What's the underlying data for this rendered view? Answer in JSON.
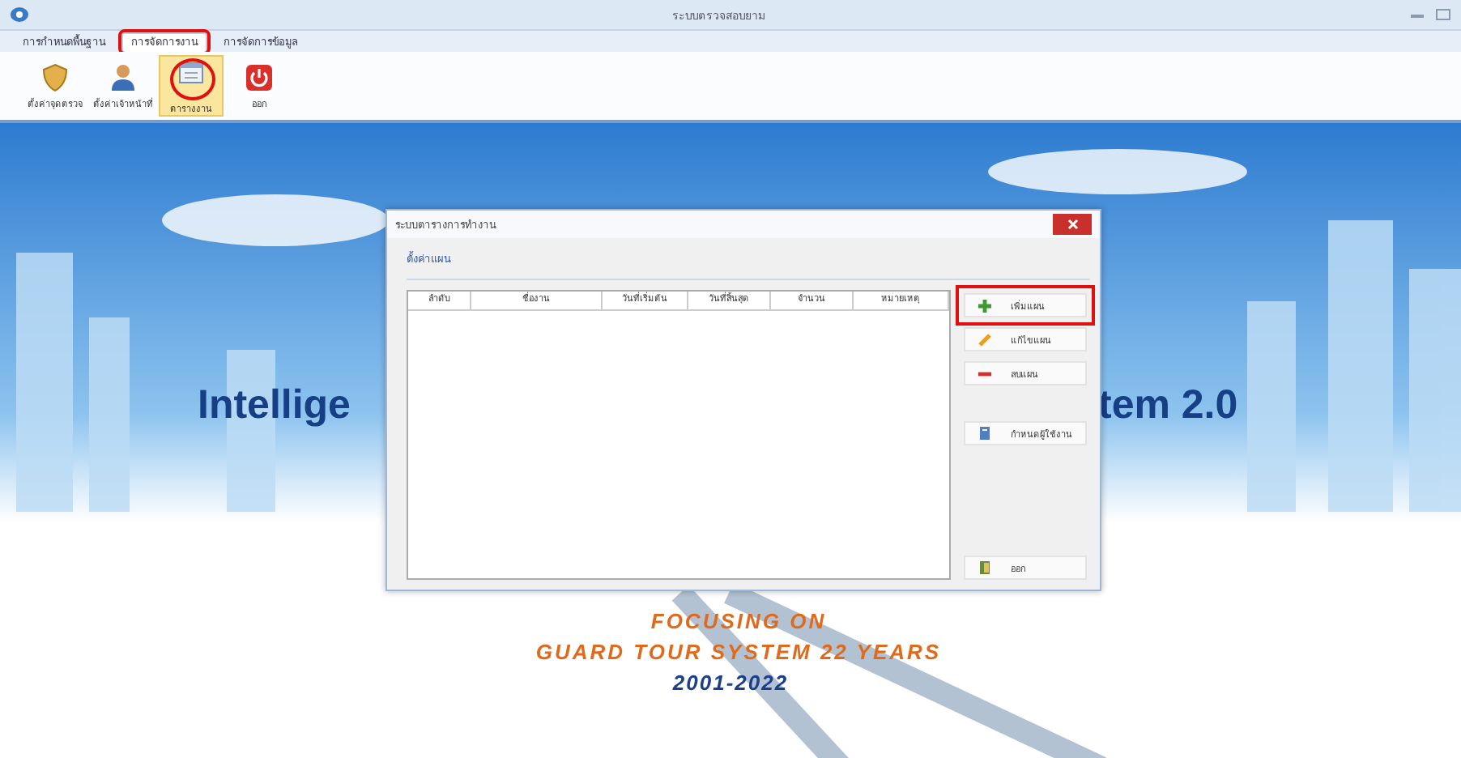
{
  "window": {
    "title": "ระบบตรวจสอบยาม"
  },
  "tabs": [
    {
      "label": "การกำหนดพื้นฐาน",
      "selected": false,
      "annotated": false
    },
    {
      "label": "การจัดการงาน",
      "selected": true,
      "annotated": true
    },
    {
      "label": "การจัดการข้อมูล",
      "selected": false,
      "annotated": false
    }
  ],
  "toolbar": [
    {
      "kind": "checkpoint",
      "label": "ตั้งค่าจุดตรวจ",
      "selected": false,
      "annotated": false
    },
    {
      "kind": "user",
      "label": "ตั้งค่าเจ้าหน้าที่",
      "selected": false,
      "annotated": false
    },
    {
      "kind": "schedule",
      "label": "ตารางงาน",
      "selected": true,
      "annotated": true
    },
    {
      "kind": "exit",
      "label": "ออก",
      "selected": false,
      "annotated": false
    }
  ],
  "banner": {
    "headline_left": "Intellige",
    "headline_right": "tem 2.0",
    "tagline": [
      "FOCUSING ON",
      "GUARD TOUR SYSTEM 22 YEARS"
    ],
    "years": "2001-2022"
  },
  "dialog": {
    "title": "ระบบตารางการทำงาน",
    "subtab": "ตั้งค่าแผน",
    "table": {
      "columns": [
        "ลำดับ",
        "ชื่องาน",
        "วันที่เริ่มต้น",
        "วันที่สิ้นสุด",
        "จำนวน",
        "หมายเหตุ"
      ]
    },
    "buttons": [
      {
        "kind": "add",
        "label": "เพิ่มแผน",
        "annotated": true
      },
      {
        "kind": "edit",
        "label": "แก้ไขแผน",
        "annotated": false
      },
      {
        "kind": "delete",
        "label": "ลบแผน",
        "annotated": false
      },
      {
        "kind": "assign",
        "label": "กำหนดผู้ใช้งาน",
        "annotated": false
      },
      {
        "kind": "exit",
        "label": "ออก",
        "annotated": false
      }
    ]
  }
}
